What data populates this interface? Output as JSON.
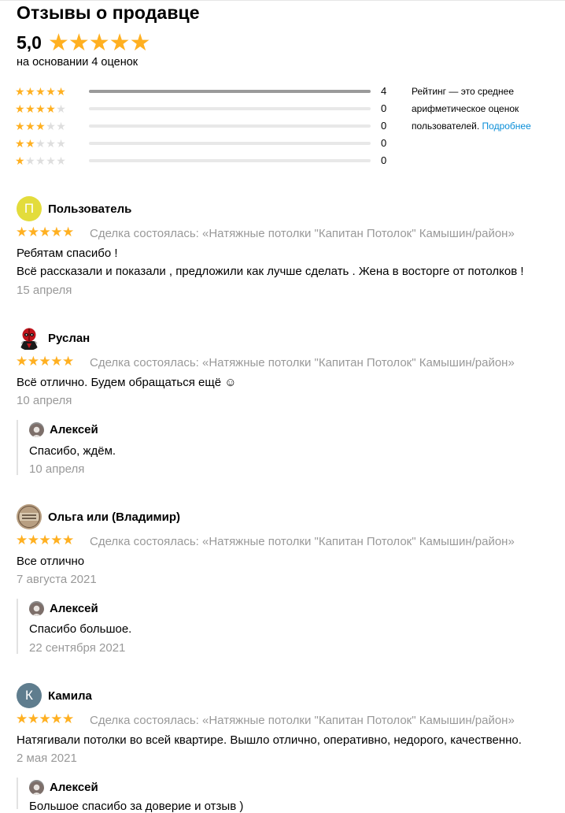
{
  "header": {
    "title": "Отзывы о продавце",
    "score": "5,0",
    "score_stars": "★★★★★",
    "based_on": "на основании 4 оценок"
  },
  "histogram": [
    {
      "stars": 5,
      "count": "4",
      "fraction": 1.0
    },
    {
      "stars": 4,
      "count": "0",
      "fraction": 0
    },
    {
      "stars": 3,
      "count": "0",
      "fraction": 0
    },
    {
      "stars": 2,
      "count": "0",
      "fraction": 0
    },
    {
      "stars": 1,
      "count": "0",
      "fraction": 0
    }
  ],
  "rating_note": {
    "line1": "Рейтинг — это среднее",
    "line2": "арифметическое оценок",
    "line3": "пользователей.",
    "link": "Подробнее"
  },
  "colors": {
    "star": "#ffb021",
    "star_empty": "#dedede",
    "link": "#0a8ed8",
    "muted": "#999999",
    "avatar_p": "#e3dc3c",
    "avatar_k": "#5f7d8e"
  },
  "reviews": [
    {
      "author": "Пользователь",
      "avatar_letter": "П",
      "stars": "★★★★★",
      "deal": "Сделка состоялась: «Натяжные потолки \"Капитан Потолок\" Камышин/район»",
      "text1": "Ребятам спасибо !",
      "text2": "Всё рассказали и показали , предложили как лучше сделать . Жена в восторге от потолков !",
      "date": "15 апреля"
    },
    {
      "author": "Руслан",
      "avatar_icon": "deadpool-avatar-icon",
      "stars": "★★★★★",
      "deal": "Сделка состоялась: «Натяжные потолки \"Капитан Потолок\" Камышин/район»",
      "text1": "Всё отлично. Будем обращаться ещё ☺",
      "date": "10 апреля",
      "reply": {
        "author": "Алексей",
        "text": "Спасибо, ждём.",
        "date": "10 апреля"
      }
    },
    {
      "author": "Ольга или (Владимир)",
      "avatar_icon": "badge-avatar-icon",
      "stars": "★★★★★",
      "deal": "Сделка состоялась: «Натяжные потолки \"Капитан Потолок\" Камышин/район»",
      "text1": "Все отлично",
      "date": "7 августа 2021",
      "reply": {
        "author": "Алексей",
        "text": "Спасибо большое.",
        "date": "22 сентября 2021"
      }
    },
    {
      "author": "Камила",
      "avatar_letter": "К",
      "stars": "★★★★★",
      "deal": "Сделка состоялась: «Натяжные потолки \"Капитан Потолок\" Камышин/район»",
      "text1": "Натягивали потолки во всей квартире. Вышло отлично, оперативно, недорого, качественно.",
      "date": "2 мая 2021",
      "reply": {
        "author": "Алексей",
        "text": "Большое спасибо за доверие и отзыв )"
      }
    }
  ]
}
